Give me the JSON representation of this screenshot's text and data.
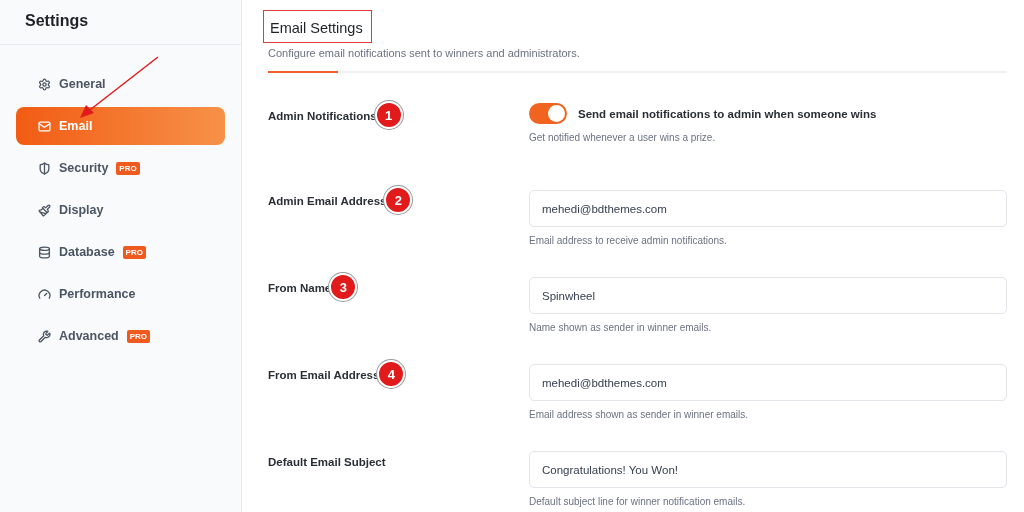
{
  "sidebar": {
    "title": "Settings",
    "items": [
      {
        "label": "General",
        "kind": "gear",
        "selected": false
      },
      {
        "label": "Email",
        "kind": "mail",
        "selected": true
      },
      {
        "label": "Security",
        "kind": "shield",
        "selected": false,
        "badge": "PRO"
      },
      {
        "label": "Display",
        "kind": "brush",
        "selected": false
      },
      {
        "label": "Database",
        "kind": "database",
        "selected": false,
        "badge": "PRO"
      },
      {
        "label": "Performance",
        "kind": "gauge",
        "selected": false
      },
      {
        "label": "Advanced",
        "kind": "wrench",
        "selected": false,
        "badge": "PRO"
      }
    ]
  },
  "main": {
    "title": "Email Settings",
    "subtitle": "Configure email notifications sent to winners and administrators.",
    "fields": [
      {
        "kind": "toggle",
        "label": "Admin Notifications",
        "marker": "1",
        "on": true,
        "toggle_label": "Send email notifications to admin when someone wins",
        "help": "Get notified whenever a user wins a prize."
      },
      {
        "kind": "text",
        "label": "Admin Email Address",
        "marker": "2",
        "value": "mehedi@bdthemes.com",
        "help": "Email address to receive admin notifications."
      },
      {
        "kind": "text",
        "label": "From Name",
        "marker": "3",
        "value": "Spinwheel",
        "help": "Name shown as sender in winner emails."
      },
      {
        "kind": "text",
        "label": "From Email Address",
        "marker": "4",
        "value": "mehedi@bdthemes.com",
        "help": "Email address shown as sender in winner emails."
      },
      {
        "kind": "text",
        "label": "Default Email Subject",
        "value": "Congratulations! You Won!",
        "help": "Default subject line for winner notification emails."
      }
    ]
  }
}
